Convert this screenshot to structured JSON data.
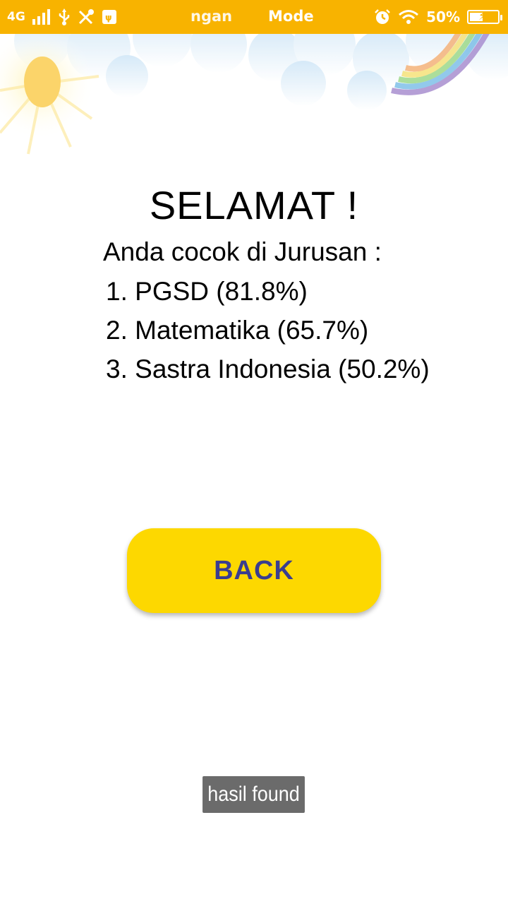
{
  "status_bar": {
    "network": "4G",
    "ticker_left": "ngan",
    "ticker_right": "Mode",
    "battery": "50%",
    "battery_level": 0.5,
    "icons": [
      "signal-icon",
      "usb-icon",
      "tools-icon",
      "debug-icon",
      "alarm-icon",
      "wifi-icon",
      "battery-icon"
    ]
  },
  "result": {
    "title": "SELAMAT !",
    "subtitle": "Anda cocok di Jurusan :",
    "items": [
      "1. PGSD (81.8%)",
      "2. Matematika (65.7%)",
      "3. Sastra Indonesia (50.2%)"
    ]
  },
  "back_button": {
    "label": "BACK"
  },
  "toast": {
    "message": "hasil found"
  },
  "colors": {
    "status_bar": "#f8b300",
    "button": "#fdd800",
    "button_text": "#3a3d8f",
    "toast": "#6b6b6b"
  }
}
